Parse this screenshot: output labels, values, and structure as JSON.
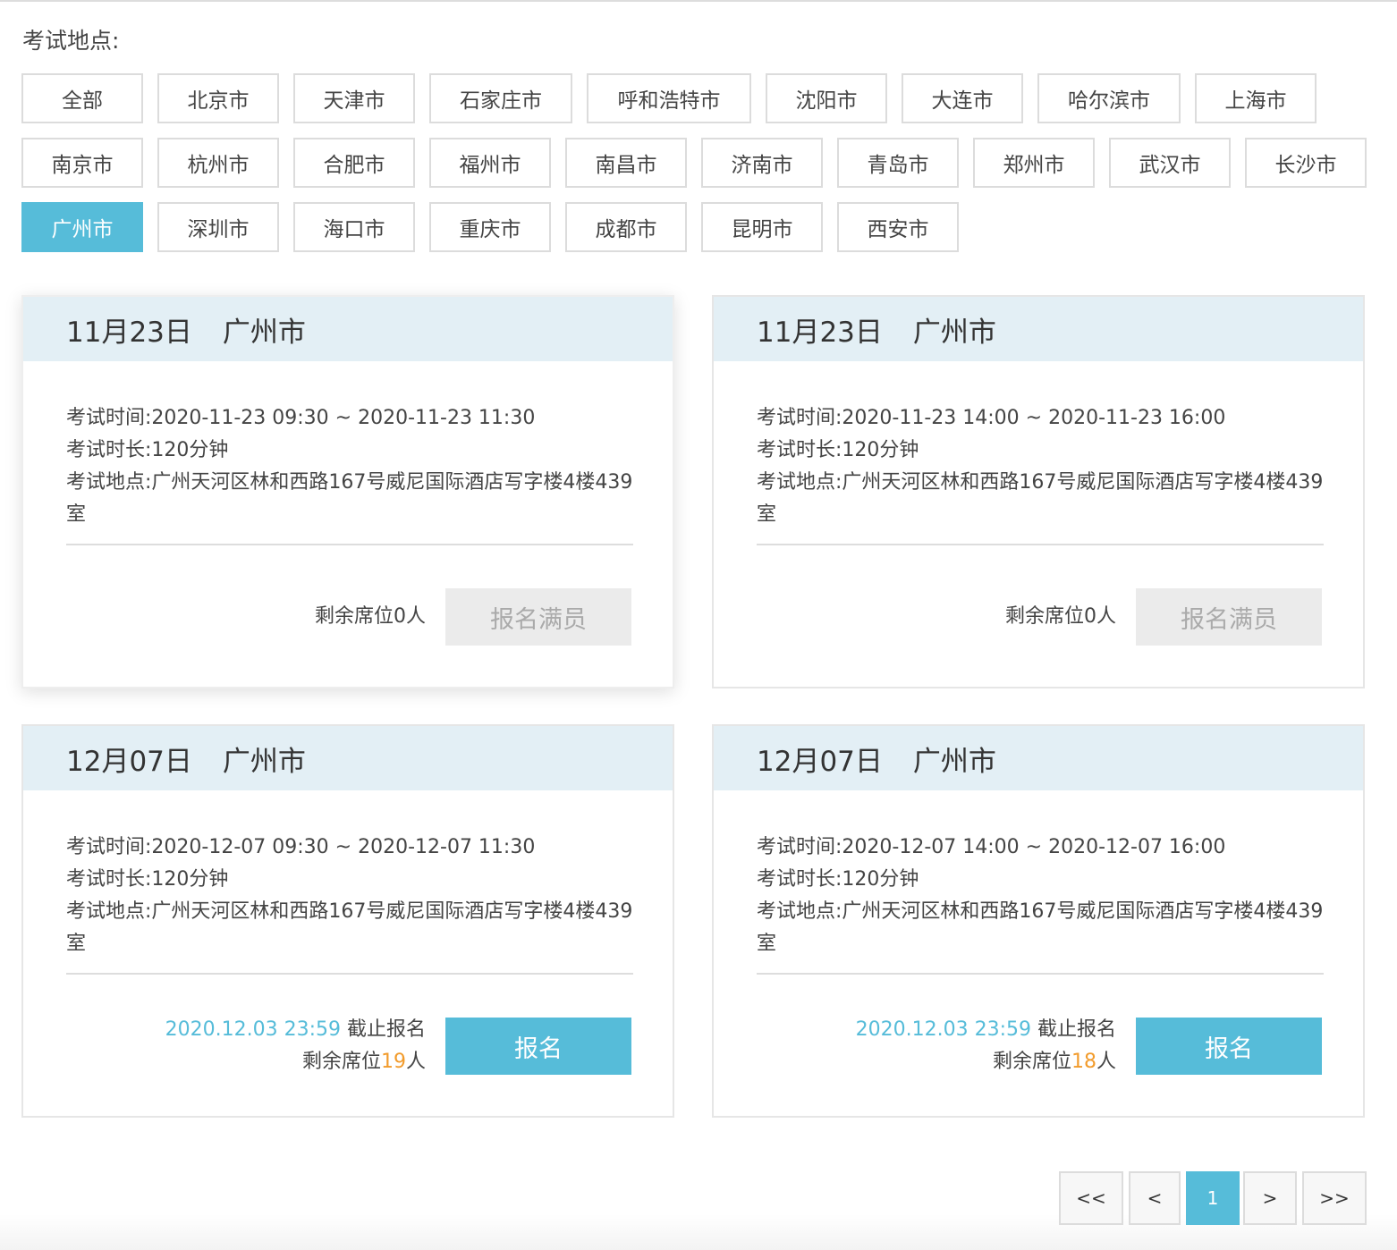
{
  "location_label": "考试地点:",
  "cities": [
    {
      "label": "全部",
      "active": false
    },
    {
      "label": "北京市",
      "active": false
    },
    {
      "label": "天津市",
      "active": false
    },
    {
      "label": "石家庄市",
      "active": false
    },
    {
      "label": "呼和浩特市",
      "active": false
    },
    {
      "label": "沈阳市",
      "active": false
    },
    {
      "label": "大连市",
      "active": false
    },
    {
      "label": "哈尔滨市",
      "active": false
    },
    {
      "label": "上海市",
      "active": false
    },
    {
      "label": "南京市",
      "active": false
    },
    {
      "label": "杭州市",
      "active": false
    },
    {
      "label": "合肥市",
      "active": false
    },
    {
      "label": "福州市",
      "active": false
    },
    {
      "label": "南昌市",
      "active": false
    },
    {
      "label": "济南市",
      "active": false
    },
    {
      "label": "青岛市",
      "active": false
    },
    {
      "label": "郑州市",
      "active": false
    },
    {
      "label": "武汉市",
      "active": false
    },
    {
      "label": "长沙市",
      "active": false
    },
    {
      "label": "广州市",
      "active": true
    },
    {
      "label": "深圳市",
      "active": false
    },
    {
      "label": "海口市",
      "active": false
    },
    {
      "label": "重庆市",
      "active": false
    },
    {
      "label": "成都市",
      "active": false
    },
    {
      "label": "昆明市",
      "active": false
    },
    {
      "label": "西安市",
      "active": false
    }
  ],
  "labels": {
    "time": "考试时间:",
    "duration": "考试时长:",
    "place": "考试地点:"
  },
  "sessions": [
    {
      "date": "11月23日",
      "city": "广州市",
      "time": "2020-11-23 09:30 ~ 2020-11-23 11:30",
      "duration": "120分钟",
      "address": "广州天河区林和西路167号威尼国际酒店写字楼4楼439室",
      "seats_text": "剩余席位0人",
      "button": "报名满员"
    },
    {
      "date": "11月23日",
      "city": "广州市",
      "time": "2020-11-23 14:00 ~ 2020-11-23 16:00",
      "duration": "120分钟",
      "address": "广州天河区林和西路167号威尼国际酒店写字楼4楼439室",
      "seats_text": "剩余席位0人",
      "button": "报名满员"
    },
    {
      "date": "12月07日",
      "city": "广州市",
      "time": "2020-12-07 09:30 ~ 2020-12-07 11:30",
      "duration": "120分钟",
      "address": "广州天河区林和西路167号威尼国际酒店写字楼4楼439室",
      "deadline_date": "2020.12.03 23:59",
      "deadline_suffix": " 截止报名",
      "seats_prefix": "剩余席位",
      "seats_count": "19",
      "seats_suffix": "人",
      "button": "报名"
    },
    {
      "date": "12月07日",
      "city": "广州市",
      "time": "2020-12-07 14:00 ~ 2020-12-07 16:00",
      "duration": "120分钟",
      "address": "广州天河区林和西路167号威尼国际酒店写字楼4楼439室",
      "deadline_date": "2020.12.03 23:59",
      "deadline_suffix": " 截止报名",
      "seats_prefix": "剩余席位",
      "seats_count": "18",
      "seats_suffix": "人",
      "button": "报名"
    }
  ],
  "pagination": {
    "first": "<<",
    "prev": "<",
    "current": "1",
    "next": ">",
    "last": ">>"
  },
  "colors": {
    "accent": "#56bcd9",
    "seat_highlight": "#f29b2b",
    "card_header": "#e3eff5"
  }
}
